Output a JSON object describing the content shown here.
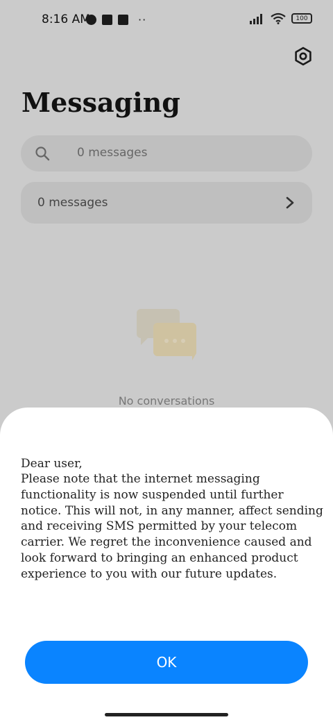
{
  "status_bar": {
    "time": "8:16 AM",
    "battery": "100",
    "icons": [
      "vpn-circle-icon",
      "square-notification-icon",
      "upload-notification-icon",
      "more-dots-icon",
      "signal-icon",
      "wifi-icon",
      "battery-icon"
    ]
  },
  "header": {
    "title": "Messaging",
    "settings_icon": "settings-icon"
  },
  "search": {
    "placeholder": "0 messages"
  },
  "summary": {
    "label": "0 messages"
  },
  "empty_state": {
    "label": "No conversations"
  },
  "dialog": {
    "greeting": "Dear user,",
    "body": "Please note that the internet messaging functionality is now suspended until further notice. This will not, in any manner, affect sending and receiving SMS permitted by your telecom carrier. We regret the inconvenience caused and look forward to bringing an enhanced product experience to you with our future updates.",
    "ok_label": "OK"
  },
  "colors": {
    "accent": "#0a84ff",
    "dimmed_background": "#cbcbcb",
    "sheet": "#ffffff"
  }
}
